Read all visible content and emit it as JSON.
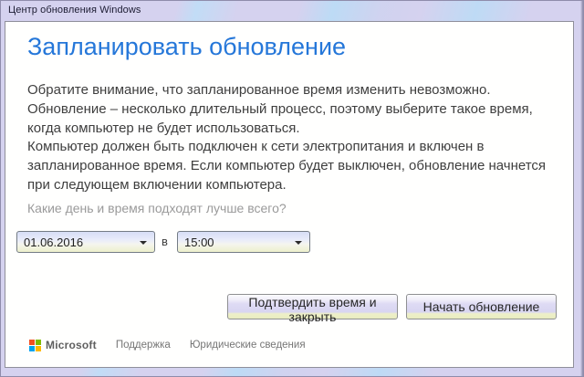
{
  "window": {
    "title": "Центр обновления Windows"
  },
  "main": {
    "heading": "Запланировать обновление",
    "paragraph1": "Обратите внимание, что запланированное время изменить невозможно. Обновление – несколько длительный процесс, поэтому выберите такое время, когда компьютер не будет использоваться.",
    "paragraph2": "Компьютер должен быть подключен к сети электропитания и включен в запланированное время. Если компьютер будет выключен, обновление начнется при следующем включении компьютера.",
    "question": "Какие день и время подходят лучше всего?",
    "schedule": {
      "date_value": "01.06.2016",
      "separator_label": "в",
      "time_value": "15:00"
    },
    "buttons": {
      "confirm_label": "Подтвердить время и закрыть",
      "start_label": "Начать обновление"
    }
  },
  "footer": {
    "brand": "Microsoft",
    "links": [
      {
        "label": "Поддержка"
      },
      {
        "label": "Юридические сведения"
      }
    ]
  },
  "colors": {
    "accent_blue": "#2577d9",
    "frame_lavender": "#d5d2ef",
    "body_text": "#3e3e3e",
    "muted_text": "#9a9a9a",
    "ms_red": "#f25022",
    "ms_green": "#7fba00",
    "ms_blue": "#00a4ef",
    "ms_yellow": "#ffb900"
  }
}
